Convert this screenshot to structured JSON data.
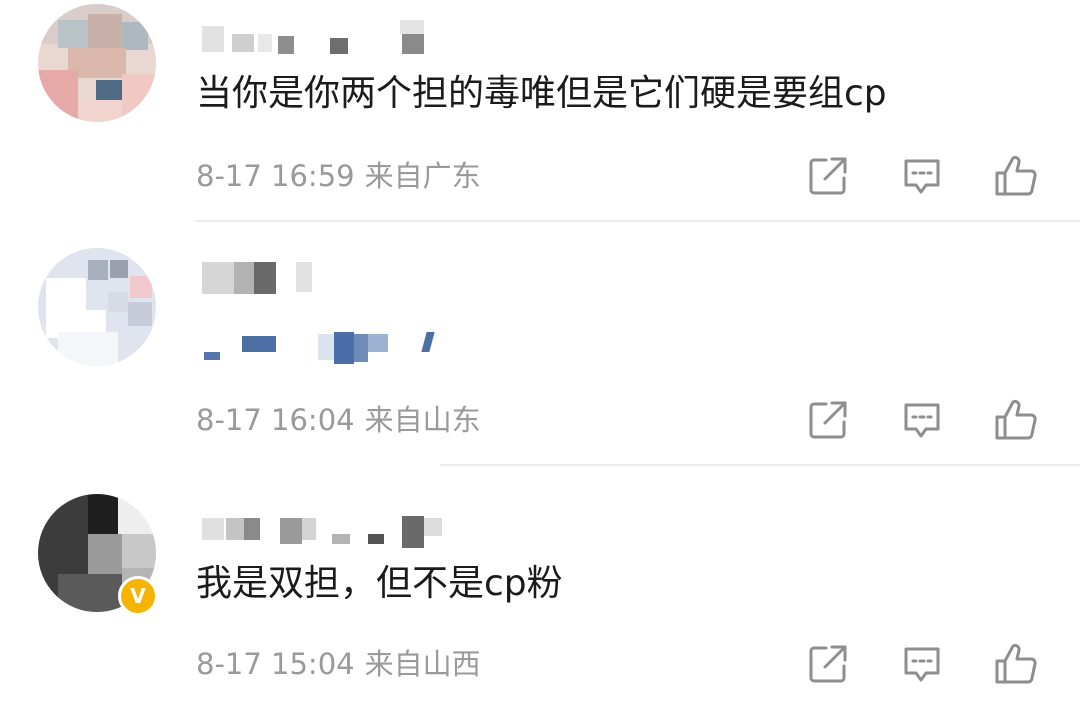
{
  "comments": [
    {
      "text": "当你是你两个担的毒唯但是它们硬是要组cp",
      "time": "8-17 16:59",
      "location": "来自广东",
      "verified": false
    },
    {
      "text": "",
      "time": "8-17 16:04",
      "location": "来自山东",
      "verified": false
    },
    {
      "text": "我是双担，但不是cp粉",
      "time": "8-17 15:04",
      "location": "来自山西",
      "verified": true,
      "verified_mark": "V"
    }
  ],
  "icons": {
    "share": "share-icon",
    "reply": "comment-icon",
    "like": "thumbs-up-icon"
  },
  "colors": {
    "text": "#1b1b1b",
    "meta": "#9a9a9a",
    "icon": "#8e8e8e",
    "verified": "#f5b400",
    "divider": "#ececec"
  }
}
